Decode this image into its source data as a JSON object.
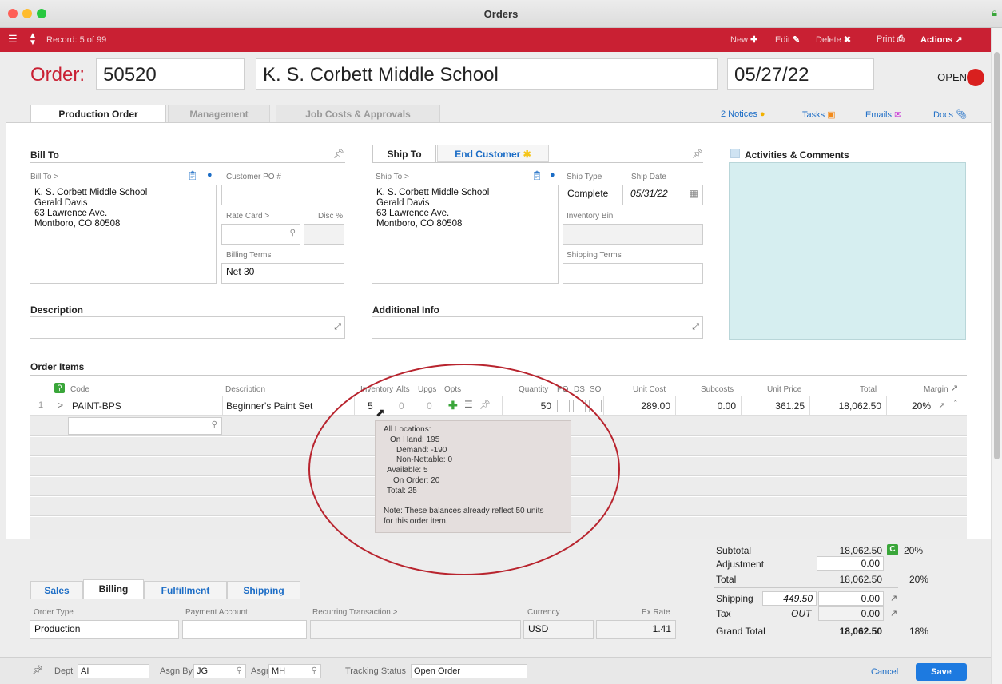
{
  "window": {
    "title": "Orders"
  },
  "recordbar": {
    "record": "Record: 5 of 99",
    "new_label": "New",
    "edit_label": "Edit",
    "delete_label": "Delete",
    "print_label": "Print",
    "actions_label": "Actions"
  },
  "header": {
    "order_label": "Order:",
    "order_number": "50520",
    "customer_name": "K. S. Corbett Middle School",
    "date": "05/27/22",
    "status": "OPEN"
  },
  "tabs": [
    "Production Order",
    "Management",
    "Job Costs & Approvals"
  ],
  "toplinks": {
    "notices": "2 Notices",
    "tasks": "Tasks",
    "emails": "Emails",
    "docs": "Docs"
  },
  "bill_to": {
    "title": "Bill To",
    "label": "Bill To >",
    "address": [
      "K. S. Corbett Middle School",
      "Gerald Davis",
      "63 Lawrence Ave.",
      "Montboro, CO 80508"
    ],
    "customer_po_label": "Customer PO #",
    "customer_po": "",
    "rate_card_label": "Rate Card >",
    "disc_label": "Disc %",
    "billing_terms_label": "Billing Terms",
    "billing_terms": "Net 30"
  },
  "ship_to": {
    "tab_label": "Ship To",
    "end_customer_label": "End Customer",
    "label": "Ship To >",
    "address": [
      "K. S. Corbett Middle School",
      "Gerald Davis",
      "63 Lawrence Ave.",
      "Montboro, CO 80508"
    ],
    "ship_type_label": "Ship Type",
    "ship_type": "Complete",
    "ship_date_label": "Ship Date",
    "ship_date": "05/31/22",
    "inventory_bin_label": "Inventory Bin",
    "shipping_terms_label": "Shipping Terms"
  },
  "activities": {
    "title": "Activities & Comments"
  },
  "description": {
    "title": "Description"
  },
  "additional_info": {
    "title": "Additional Info"
  },
  "order_items": {
    "title": "Order Items",
    "columns": [
      "Code",
      "Description",
      "Inventory",
      "Alts",
      "Upgs",
      "Opts",
      "Quantity",
      "PO",
      "DS",
      "SO",
      "Unit Cost",
      "Subcosts",
      "Unit Price",
      "Total",
      "Margin"
    ],
    "rows": [
      {
        "num": "1",
        "code": "PAINT-BPS",
        "description": "Beginner's Paint Set",
        "inventory": "5",
        "alts": "0",
        "upgs": "0",
        "quantity": "50",
        "unit_cost": "289.00",
        "subcosts": "0.00",
        "unit_price": "361.25",
        "total": "18,062.50",
        "margin": "20%"
      }
    ]
  },
  "tooltip": {
    "lines": [
      "All Locations:",
      "On Hand: 195",
      "Demand: -190",
      "Non-Nettable: 0",
      "Available: 5",
      "On Order: 20",
      "Total: 25",
      "",
      "Note: These balances already reflect 50 units",
      "for this order item."
    ]
  },
  "bottom_tabs": [
    "Sales",
    "Billing",
    "Fulfillment",
    "Shipping"
  ],
  "billing": {
    "order_type_label": "Order Type",
    "order_type": "Production",
    "payment_account_label": "Payment Account",
    "recurring_label": "Recurring Transaction >",
    "currency_label": "Currency",
    "currency": "USD",
    "ex_rate_label": "Ex Rate",
    "ex_rate": "1.41"
  },
  "totals": {
    "subtotal_label": "Subtotal",
    "subtotal": "18,062.50",
    "subtotal_margin": "20%",
    "adjustment_label": "Adjustment",
    "adjustment": "0.00",
    "total_label": "Total",
    "total": "18,062.50",
    "total_margin": "20%",
    "shipping_label": "Shipping",
    "shipping_cost": "449.50",
    "shipping": "0.00",
    "tax_label": "Tax",
    "tax_code": "OUT",
    "tax": "0.00",
    "grand_total_label": "Grand Total",
    "grand_total": "18,062.50",
    "grand_margin": "18%"
  },
  "footer": {
    "dept_label": "Dept",
    "dept": "AI",
    "asgn_by_label": "Asgn By",
    "asgn_by": "JG",
    "asgn_to_label": "Asgn To",
    "asgn_to": "MH",
    "tracking_label": "Tracking Status",
    "tracking": "Open Order",
    "cancel_label": "Cancel",
    "save_label": "Save"
  },
  "colors": {
    "brand_red": "#c92033",
    "link_blue": "#1c6dc6",
    "status_red": "#d9201f",
    "save_blue": "#1d7ae0",
    "activities_bg": "#d6eef0"
  }
}
